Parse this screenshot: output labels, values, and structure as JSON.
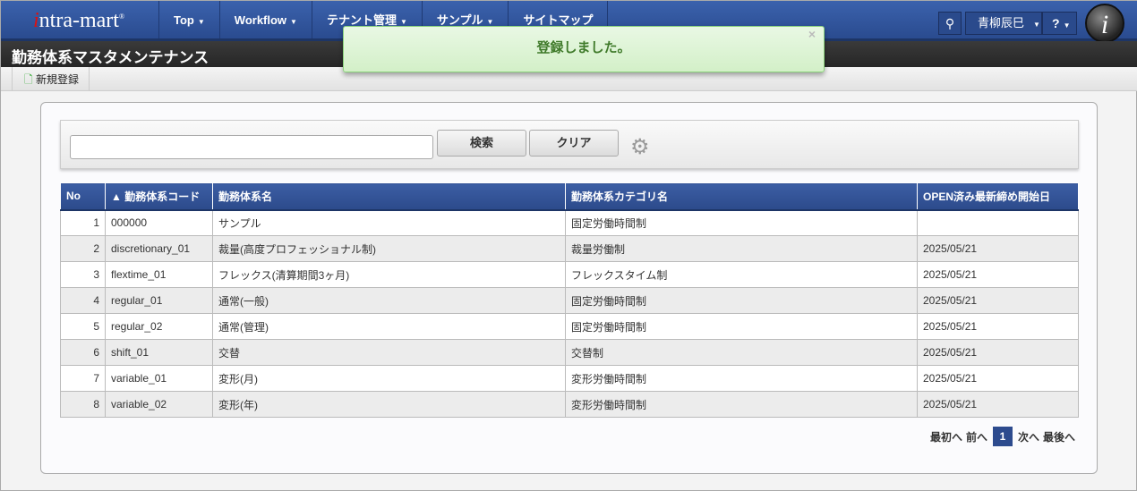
{
  "header": {
    "logo": "intra-mart",
    "nav": [
      "Top",
      "Workflow",
      "テナント管理",
      "サンプル",
      "サイトマップ"
    ],
    "user": "青柳辰巳",
    "help": "?"
  },
  "page_title": "勤務体系マスタメンテナンス",
  "toolbar": {
    "new_label": "新規登録"
  },
  "toast": {
    "message": "登録しました。",
    "close": "×"
  },
  "search": {
    "value": "",
    "search_label": "検索",
    "clear_label": "クリア"
  },
  "table": {
    "headers": [
      "No",
      "▲ 勤務体系コード",
      "勤務体系名",
      "勤務体系カテゴリ名",
      "OPEN済み最新締め開始日"
    ],
    "rows": [
      [
        "1",
        "000000",
        "サンプル",
        "固定労働時間制",
        ""
      ],
      [
        "2",
        "discretionary_01",
        "裁量(高度プロフェッショナル制)",
        "裁量労働制",
        "2025/05/21"
      ],
      [
        "3",
        "flextime_01",
        "フレックス(清算期間3ヶ月)",
        "フレックスタイム制",
        "2025/05/21"
      ],
      [
        "4",
        "regular_01",
        "通常(一般)",
        "固定労働時間制",
        "2025/05/21"
      ],
      [
        "5",
        "regular_02",
        "通常(管理)",
        "固定労働時間制",
        "2025/05/21"
      ],
      [
        "6",
        "shift_01",
        "交替",
        "交替制",
        "2025/05/21"
      ],
      [
        "7",
        "variable_01",
        "変形(月)",
        "変形労働時間制",
        "2025/05/21"
      ],
      [
        "8",
        "variable_02",
        "変形(年)",
        "変形労働時間制",
        "2025/05/21"
      ]
    ]
  },
  "pager": {
    "first": "最初へ",
    "prev": "前へ",
    "current": "1",
    "next": "次へ",
    "last": "最後へ"
  }
}
